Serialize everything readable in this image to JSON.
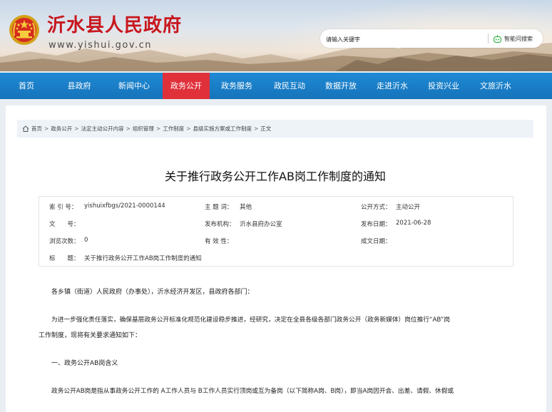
{
  "header": {
    "site_title": "沂水县人民政府",
    "site_url": "www.yishui.gov.cn",
    "search_placeholder": "请输入关键字",
    "ai_search_label": "智能问搜索"
  },
  "nav": {
    "items": [
      {
        "label": "首页",
        "active": false
      },
      {
        "label": "县政府",
        "active": false
      },
      {
        "label": "新闻中心",
        "active": false
      },
      {
        "label": "政务公开",
        "active": true
      },
      {
        "label": "政务服务",
        "active": false
      },
      {
        "label": "政民互动",
        "active": false
      },
      {
        "label": "数据开放",
        "active": false
      },
      {
        "label": "走进沂水",
        "active": false
      },
      {
        "label": "投资兴业",
        "active": false
      },
      {
        "label": "文旅沂水",
        "active": false
      }
    ]
  },
  "breadcrumb": {
    "items": [
      "首页",
      "政务公开",
      "法定主动公开内容",
      "组织管理",
      "工作制度",
      "县级实施方案或工作制度",
      "正文"
    ],
    "separator": ">"
  },
  "article": {
    "title": "关于推行政务公开工作AB岗工作制度的通知",
    "meta": {
      "index_label": "索 引 号：",
      "index_value": "yishuixfbgs/2021-0000144",
      "subject_label": "主 题 词：",
      "subject_value": "其他",
      "disclosure_label": "公开方式：",
      "disclosure_value": "主动公开",
      "doc_no_label": "文　　号：",
      "doc_no_value": "",
      "publisher_label": "发布机构：",
      "publisher_value": "沂水县府办公室",
      "publish_date_label": "发布日期：",
      "publish_date_value": "2021-06-28",
      "views_label": "浏览次数：",
      "views_value": "0",
      "validity_label": "有 效 性：",
      "validity_value": "",
      "created_label": "成文日期：",
      "created_value": "",
      "heading_label": "标　　题：",
      "heading_value": "关于推行政务公开工作AB岗工作制度的通知"
    },
    "paragraphs": {
      "greeting": "各乡镇（街道）人民政府（办事处），沂水经济开发区，县政府各部门：",
      "intro_line1": "为进一步强化责任落实，确保基层政务公开标准化规范化建设稳步推进，经研究，决定在全县各级各部门政务公开（政务新媒体）岗位推行“AB”岗",
      "intro_line2": "工作制度，现将有关要求通知如下：",
      "section1": "一、政务公开AB岗含义",
      "section1_text": "政务公开AB岗是指从事政务公开工作的 A工作人员与 B工作人员实行顶岗或互为备岗（以下简称A岗、B岗），即当A岗因开会、出差、请假、休假或"
    }
  },
  "colors": {
    "brand_red": "#c8161d",
    "nav_blue": "#1879c4",
    "nav_active": "#e0313b"
  }
}
